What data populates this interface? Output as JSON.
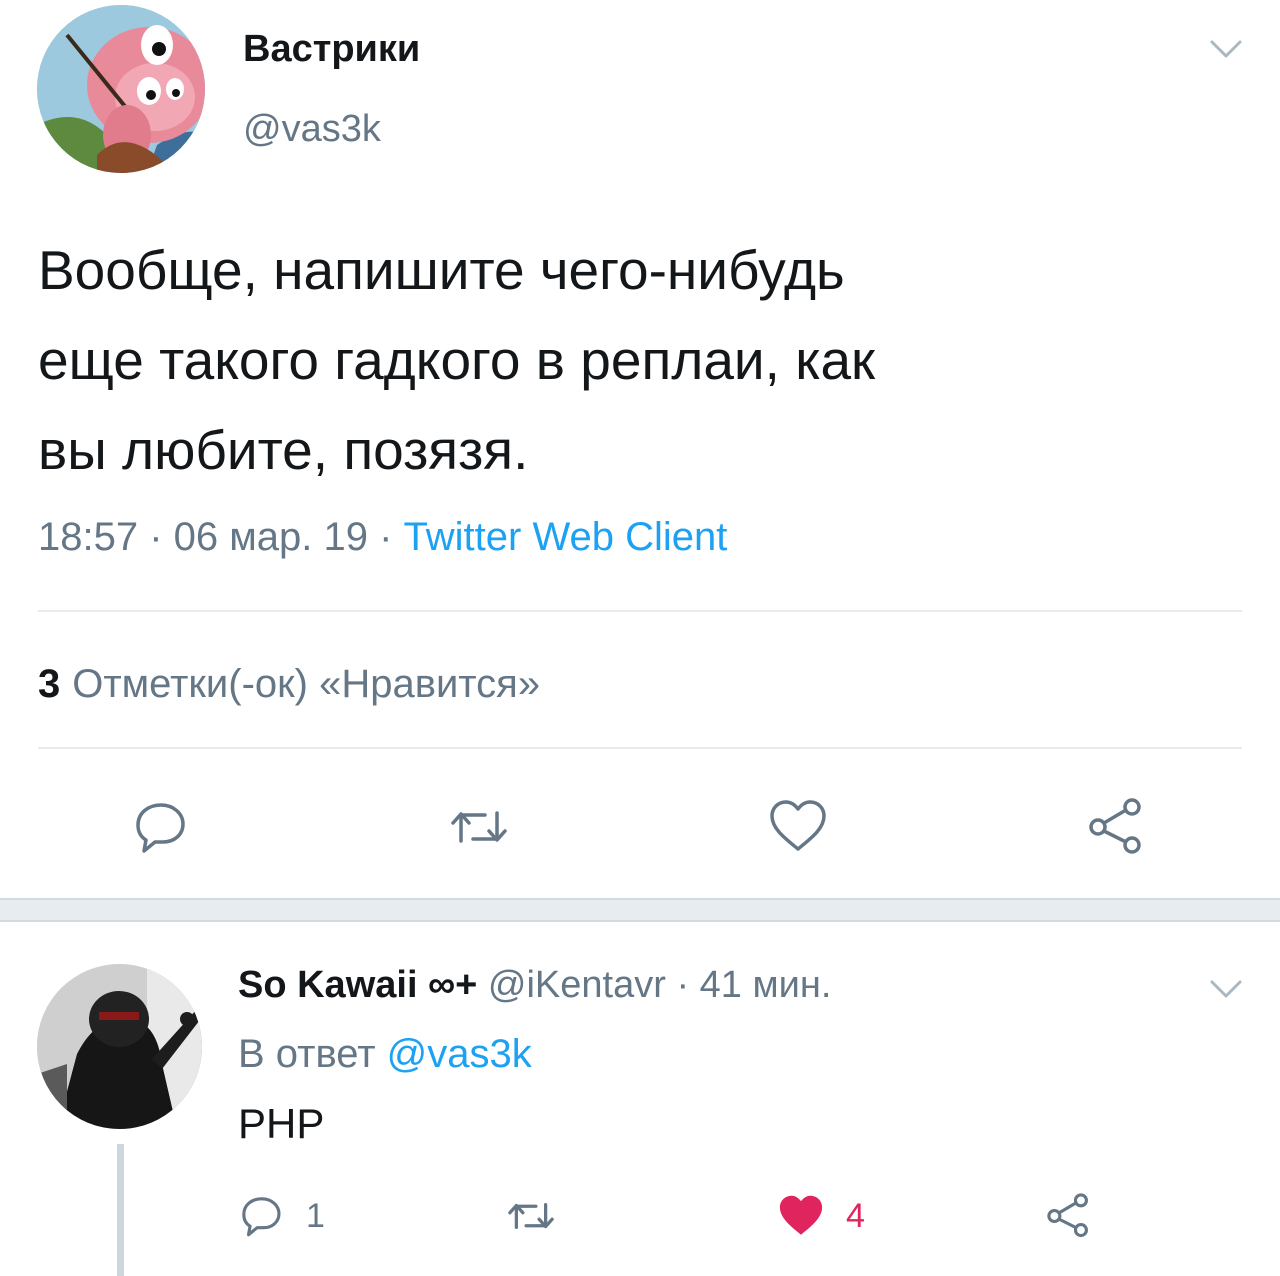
{
  "main_tweet": {
    "author_name": "Вастрики",
    "author_handle": "@vas3k",
    "text": "Вообще, напишите чего-нибудь\nеще такого гадкого в реплаи, как\nвы любите, позязя.",
    "time": "18:57",
    "date": "06 мар. 19",
    "separator": " · ",
    "source": "Twitter Web Client",
    "likes_count": "3",
    "likes_label": "Отметки(-ок) «Нравится»",
    "actions": [
      "reply-icon",
      "retweet-icon",
      "like-icon",
      "share-icon"
    ]
  },
  "reply_tweet": {
    "author_name": "So Kawaii ∞+",
    "author_handle": "@iKentavr",
    "time_ago": "41 мин.",
    "separator": " · ",
    "reply_to_prefix": "В ответ",
    "reply_to_mention": "@vas3k",
    "text": "PHP",
    "reply_count": "1",
    "like_count": "4",
    "liked": true
  },
  "colors": {
    "text_primary": "#14171a",
    "text_secondary": "#657786",
    "link": "#1da1f2",
    "like_active": "#e0245e",
    "divider": "#e6ecf0",
    "icon": "#657786"
  }
}
